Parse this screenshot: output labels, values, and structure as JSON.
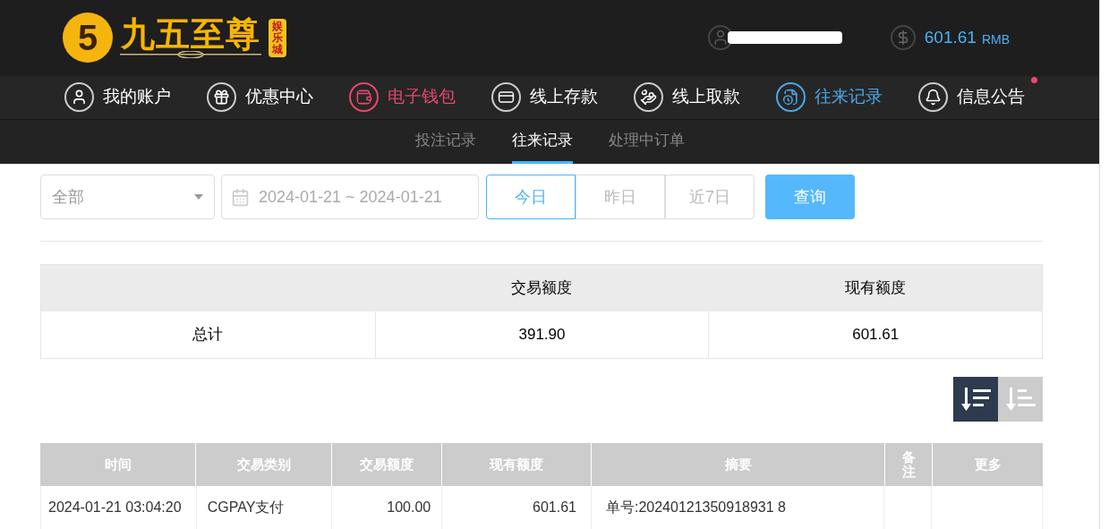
{
  "header": {
    "logo": {
      "mark": "5",
      "name": "九五至尊",
      "tag": "娱乐城"
    },
    "balance": {
      "amount": "601.61",
      "currency": "RMB"
    }
  },
  "nav": [
    {
      "label": "我的账户",
      "kind": "user",
      "color": "#ffffff",
      "badge": false
    },
    {
      "label": "优惠中心",
      "kind": "gift",
      "color": "#ffffff",
      "badge": false
    },
    {
      "label": "电子钱包",
      "kind": "wallet",
      "color": "#e8476a",
      "badge": false
    },
    {
      "label": "线上存款",
      "kind": "deposit",
      "color": "#ffffff",
      "badge": false
    },
    {
      "label": "线上取款",
      "kind": "withdraw",
      "color": "#ffffff",
      "badge": false
    },
    {
      "label": "往来记录",
      "kind": "records",
      "color": "#4aa8e8",
      "badge": false
    },
    {
      "label": "信息公告",
      "kind": "bell",
      "color": "#ffffff",
      "badge": true
    }
  ],
  "sub_tabs": [
    {
      "label": "投注记录",
      "selected": false
    },
    {
      "label": "往来记录",
      "selected": true
    },
    {
      "label": "处理中订单",
      "selected": false
    }
  ],
  "filter": {
    "type_select": "全部",
    "date_range": "2024-01-21 ~ 2024-01-21",
    "quick_ranges": [
      {
        "label": "今日",
        "selected": true
      },
      {
        "label": "昨日",
        "selected": false
      },
      {
        "label": "近7日",
        "selected": false
      }
    ],
    "query_button": "查询"
  },
  "summary": {
    "columns": [
      "交易额度",
      "现有额度"
    ],
    "row": [
      "总计",
      "391.90",
      "601.61"
    ]
  },
  "sort_buttons": [
    {
      "kind": "desc",
      "selected": true
    },
    {
      "kind": "asc",
      "selected": false
    }
  ],
  "table": {
    "columns": [
      "时间",
      "交易类别",
      "交易额度",
      "现有额度",
      "摘要",
      "备注",
      "更多"
    ],
    "rows": [
      [
        "2024-01-21 03:04:20",
        "CGPAY支付",
        "100.00",
        "601.61",
        "单号:20240121350918931 8",
        "",
        ""
      ]
    ]
  }
}
